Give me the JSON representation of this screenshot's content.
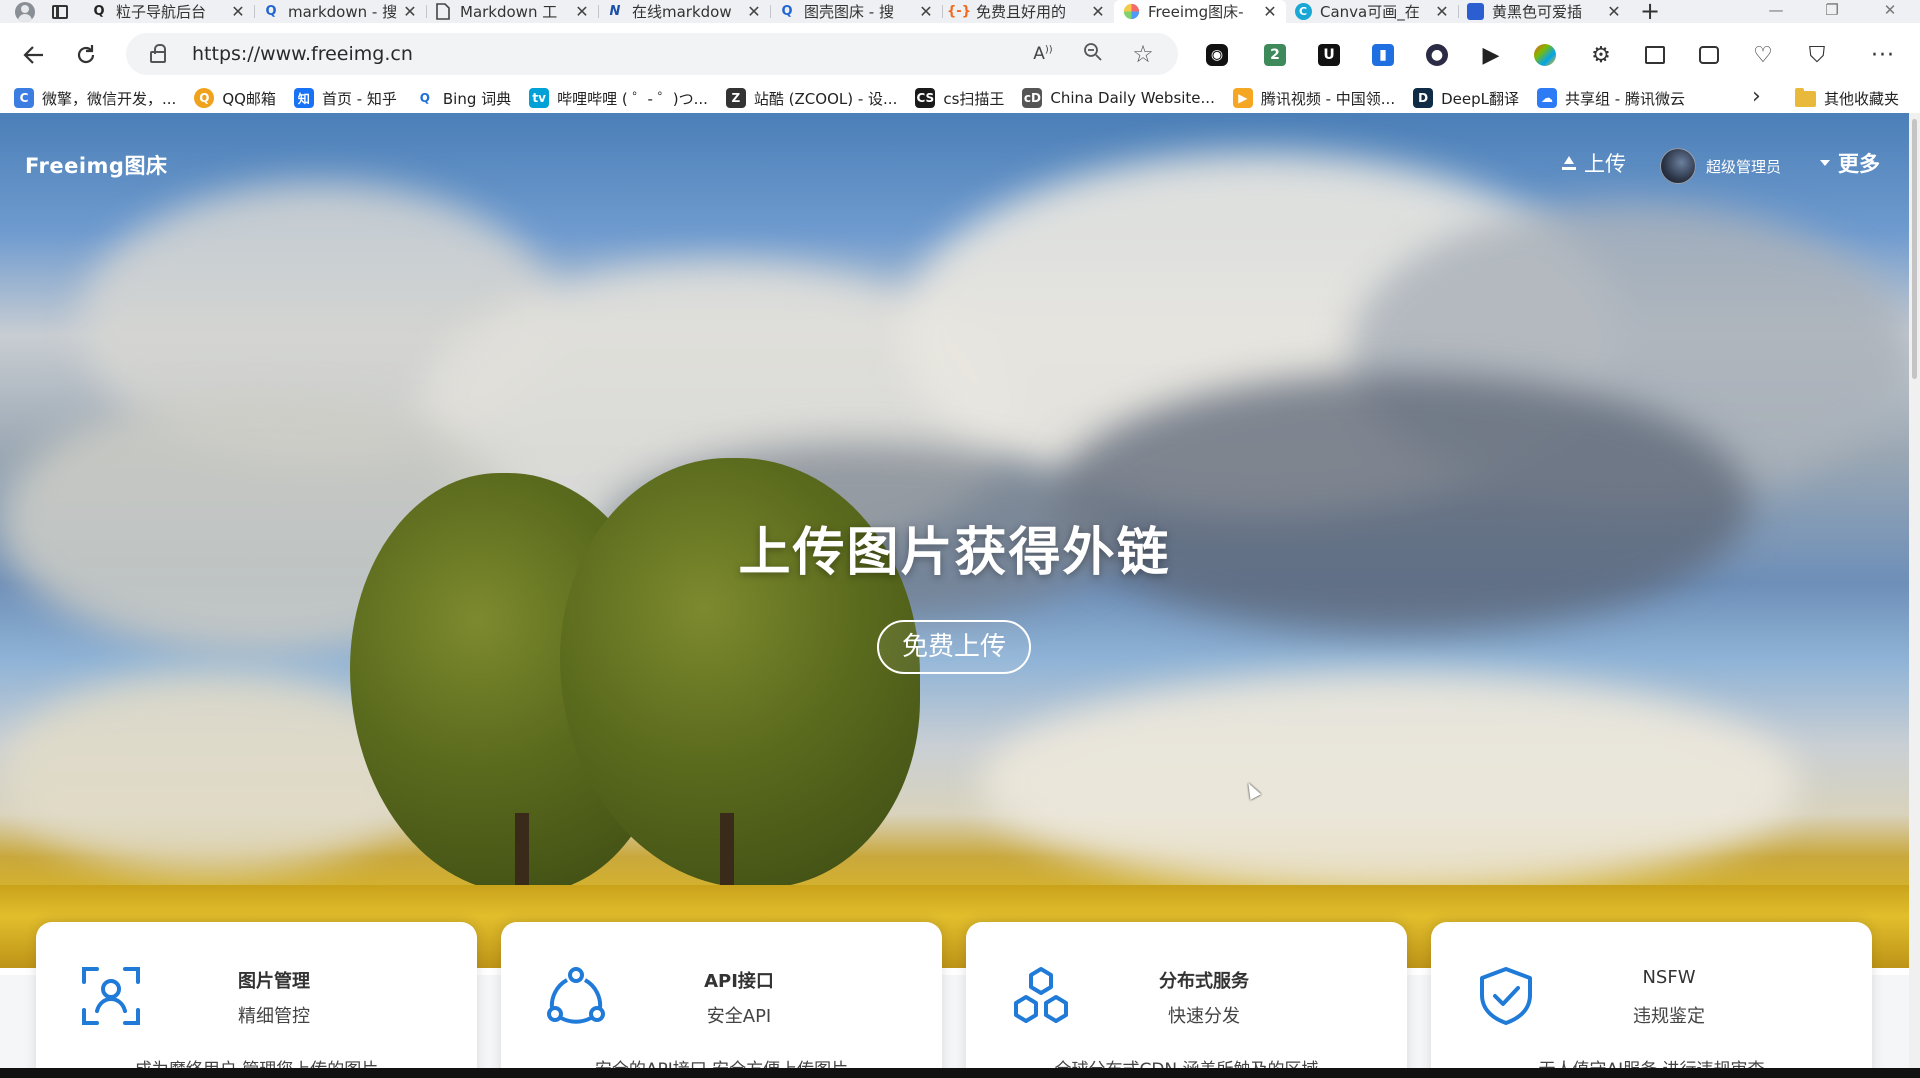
{
  "browser": {
    "tabs": [
      {
        "title": "粒子导航后台",
        "icon": "search-icon",
        "active": false
      },
      {
        "title": "markdown - 搜",
        "icon": "search-icon",
        "active": false
      },
      {
        "title": "Markdown 工",
        "icon": "document-icon",
        "active": false
      },
      {
        "title": "在线markdow",
        "icon": "n-logo-icon",
        "active": false
      },
      {
        "title": "图壳图床 - 搜",
        "icon": "search-icon",
        "active": false
      },
      {
        "title": "免费且好用的",
        "icon": "link-icon",
        "active": false
      },
      {
        "title": "Freeimg图床-",
        "icon": "pinwheel-icon",
        "active": true
      },
      {
        "title": "Canva可画_在",
        "icon": "canva-icon",
        "active": false
      },
      {
        "title": "黄黑色可爱插",
        "icon": "shield-logo-icon",
        "active": false
      }
    ],
    "url": "https://www.freeimg.cn",
    "bookmarks": [
      {
        "label": "微擎，微信开发，...",
        "color": "#3b7de0"
      },
      {
        "label": "QQ邮箱",
        "color": "#f0a21a"
      },
      {
        "label": "首页 - 知乎",
        "color": "#1772f6"
      },
      {
        "label": "Bing 词典",
        "color": "#1e6fd9"
      },
      {
        "label": "哔哩哔哩 ( ゜- ゜)つ...",
        "color": "#00a1d6"
      },
      {
        "label": "站酷 (ZCOOL) - 设...",
        "color": "#333333"
      },
      {
        "label": "cs扫描王",
        "color": "#1a1a1a"
      },
      {
        "label": "China Daily Website...",
        "color": "#555555"
      },
      {
        "label": "腾讯视频 - 中国领...",
        "color": "#f5a623"
      },
      {
        "label": "DeepL翻译",
        "color": "#0f2b46"
      },
      {
        "label": "共享组 - 腾讯微云",
        "color": "#2d7cf6"
      }
    ],
    "other_bookmarks": "其他收藏夹"
  },
  "site": {
    "brand": "Freeimg图床",
    "nav": {
      "upload": "上传",
      "user": "超级管理员",
      "more": "更多"
    },
    "hero": {
      "title": "上传图片获得外链",
      "button": "免费上传"
    },
    "features": [
      {
        "title": "图片管理",
        "subtitle": "精细管控",
        "desc": "成为魔络用户 管理您上传的图片",
        "icon": "user-focus-icon"
      },
      {
        "title": "API接口",
        "subtitle": "安全API",
        "desc": "安全的API接口 安全方便上传图片",
        "icon": "share-nodes-icon"
      },
      {
        "title": "分布式服务",
        "subtitle": "快速分发",
        "desc": "全球分布式CDN 涵盖所触及的区域",
        "icon": "hexagons-icon"
      },
      {
        "title": "NSFW",
        "subtitle": "违规鉴定",
        "desc": "无人值守AI服务 进行违规审查",
        "icon": "shield-check-icon"
      }
    ],
    "accent_color": "#1f7ad8"
  }
}
